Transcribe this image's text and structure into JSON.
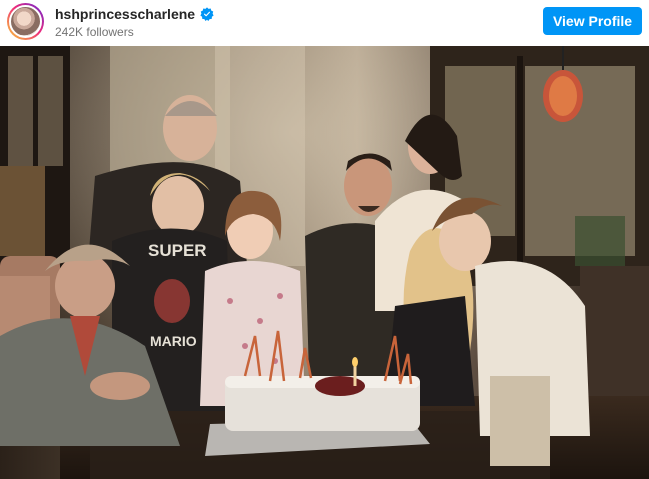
{
  "profile": {
    "handle": "hshprincesscharlene",
    "followers": "242K followers",
    "verified": true,
    "view_profile_label": "View Profile",
    "avatar_icon": "profile-avatar"
  },
  "colors": {
    "accent": "#0095f6",
    "verified_badge": "#0095f6"
  },
  "photo": {
    "shirt_text_top": "SUPER",
    "shirt_text_bottom": "MARIO"
  }
}
